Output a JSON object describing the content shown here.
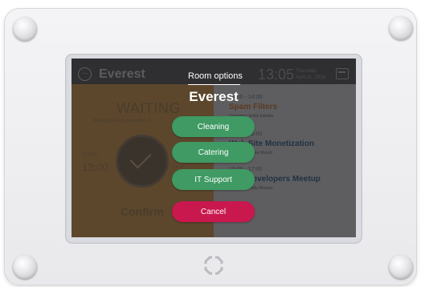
{
  "app": {
    "room_name": "Everest",
    "clock": "13:05",
    "date_line1": "Thursday",
    "date_line2": "April 21, 2016"
  },
  "status": {
    "label": "WAITING",
    "note": "Meeting will be cancelled in",
    "start_label": "START",
    "start_time": "13:00",
    "ring_side_label": "14:00",
    "confirm_label": "Confirm"
  },
  "events": [
    {
      "time": "13:00 - 14:00",
      "title": "Spam Filters",
      "organizer": "Organizer: Emily Estrella"
    },
    {
      "time": "14:00 - 15:00",
      "title": "Web Site Monetization",
      "organizer": "Organizer: Claire Munch"
    },
    {
      "time": "15:00 - 17:00",
      "title": "App Developers Meetup",
      "organizer": "Organizer: Andy Mossier"
    }
  ],
  "dialog": {
    "tab_label": "Room options",
    "title": "Everest",
    "options": [
      "Cleaning",
      "Catering",
      "IT Support"
    ],
    "cancel_label": "Cancel"
  },
  "colors": {
    "option_green": "#3f9a63",
    "cancel_red": "#c8184e",
    "status_amber": "#8a6533"
  },
  "icons": {
    "menu": "menu-dots-icon",
    "calendar": "calendar-icon",
    "logo": "device-logo-icon"
  }
}
